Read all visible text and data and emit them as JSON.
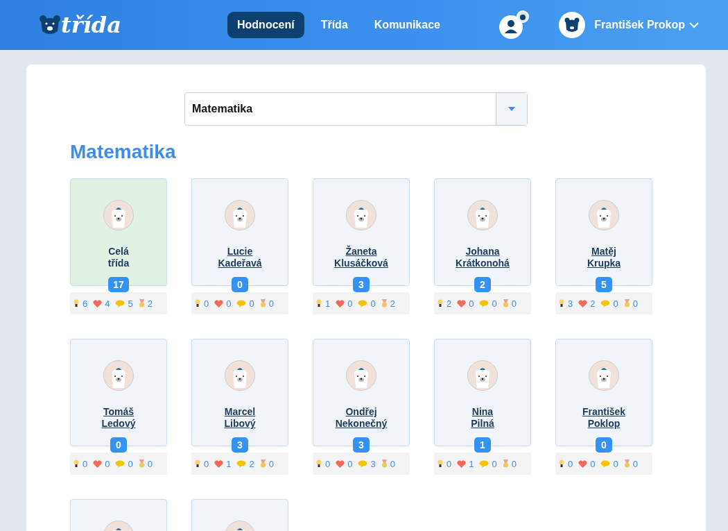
{
  "header": {
    "logo": "třída",
    "nav": [
      {
        "label": "Hodnocení",
        "selected": true
      },
      {
        "label": "Třída",
        "selected": false
      },
      {
        "label": "Komunikace",
        "selected": false
      }
    ],
    "user": "František Prokop"
  },
  "subject_select": {
    "value": "Matematika"
  },
  "heading": "Matematika",
  "cards": [
    {
      "kind": "class",
      "name": "Celá třída",
      "count": "17",
      "stats": [
        "6",
        "4",
        "5",
        "2"
      ]
    },
    {
      "kind": "student",
      "name": "Lucie Kadeřavá",
      "count": "0",
      "stats": [
        "0",
        "0",
        "0",
        "0"
      ]
    },
    {
      "kind": "student",
      "name": "Žaneta Klusáčková",
      "count": "3",
      "stats": [
        "1",
        "0",
        "0",
        "2"
      ]
    },
    {
      "kind": "student",
      "name": "Johana Krátkonohá",
      "count": "2",
      "stats": [
        "2",
        "0",
        "0",
        "0"
      ]
    },
    {
      "kind": "student",
      "name": "Matěj Krupka",
      "count": "5",
      "stats": [
        "3",
        "2",
        "0",
        "0"
      ]
    },
    {
      "kind": "student",
      "name": "Tomáš Ledový",
      "count": "0",
      "stats": [
        "0",
        "0",
        "0",
        "0"
      ]
    },
    {
      "kind": "student",
      "name": "Marcel Libový",
      "count": "3",
      "stats": [
        "0",
        "1",
        "2",
        "0"
      ]
    },
    {
      "kind": "student",
      "name": "Ondřej Nekonečný",
      "count": "3",
      "stats": [
        "0",
        "0",
        "3",
        "0"
      ]
    },
    {
      "kind": "student",
      "name": "Nina Pilná",
      "count": "1",
      "stats": [
        "0",
        "1",
        "0",
        "0"
      ]
    },
    {
      "kind": "student",
      "name": "František Poklop",
      "count": "0",
      "stats": [
        "0",
        "0",
        "0",
        "0"
      ]
    },
    {
      "kind": "partial"
    },
    {
      "kind": "partial"
    }
  ]
}
